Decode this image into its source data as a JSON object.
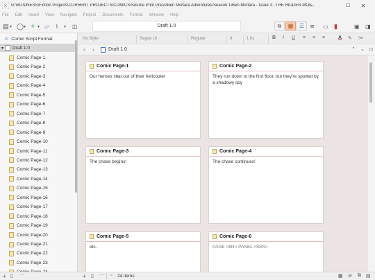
{
  "window": {
    "title": "G:\\BUSINESS\\Fiction Projects\\CURRENT PROJECTS\\COMICS\\Source Print Press\\Ben Mortara Adventures\\Season 1\\Ben Mortara - Issue 3 - THE HIDDEN MOS...",
    "minimize_icon": "minimize-icon",
    "maximize_icon": "maximize-icon",
    "close_icon": "close-icon"
  },
  "menu": [
    "File",
    "Edit",
    "Insert",
    "View",
    "Navigate",
    "Project",
    "Documents",
    "Format",
    "Window",
    "Help"
  ],
  "toolbar": {
    "document_title": "Draft 1.0"
  },
  "formatbar": {
    "paragraph_style": "No Style",
    "font_family": "Segoe UI",
    "font_weight": "Regular",
    "font_size": "9",
    "line_spacing": "1.0x",
    "bold": "B",
    "italic": "I",
    "underline": "U",
    "text_color_glyph": "A"
  },
  "binder": {
    "format_label": "Comic Script Format",
    "root_label": "Draft 1.0",
    "items": [
      "Comic Page-1",
      "Comic Page-2",
      "Comic Page-3",
      "Comic Page-4",
      "Comic Page-5",
      "Comic Page-6",
      "Comic Page-7",
      "Comic Page-8",
      "Comic Page-9",
      "Comic Page-10",
      "Comic Page-11",
      "Comic Page-12",
      "Comic Page-13",
      "Comic Page-14",
      "Comic Page-15",
      "Comic Page-16",
      "Comic Page-17",
      "Comic Page-18",
      "Comic Page-19",
      "Comic Page-20",
      "Comic Page-21",
      "Comic Page-22",
      "Comic Page-23",
      "Comic Page-24"
    ]
  },
  "editor": {
    "header_title": "Draft 1.0",
    "footer_count": "24 items"
  },
  "cards": [
    {
      "title": "Comic Page-1",
      "synopsis": "Our heroes step out of their helicopter"
    },
    {
      "title": "Comic Page-2",
      "synopsis": "They run down to the first floor, but they're spotted by a shadowy spy"
    },
    {
      "title": "Comic Page-3",
      "synopsis": "The chase begins!"
    },
    {
      "title": "Comic Page-4",
      "synopsis": "The chase continues!"
    },
    {
      "title": "Comic Page-5",
      "synopsis": "etc."
    },
    {
      "title": "Comic Page-6",
      "synopsis": "PAGE <$N> PANEL <$SN>"
    }
  ],
  "colors": {
    "corkboard": "#ece4e3",
    "card_rule": "#e6bcbc",
    "selection": "#d6d6d6"
  }
}
